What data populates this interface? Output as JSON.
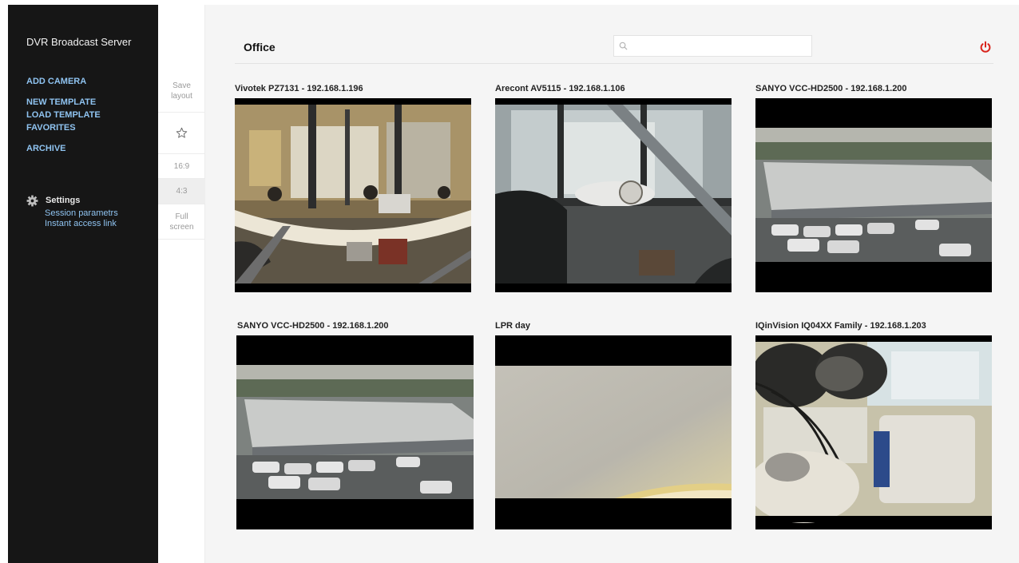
{
  "app": {
    "brand": "DVR Broadcast Server"
  },
  "sidebar": {
    "add_camera": "ADD CAMERA",
    "new_template": "NEW TEMPLATE",
    "load_template": "LOAD TEMPLATE",
    "favorites": "FAVORITES",
    "archive": "ARCHIVE",
    "settings": {
      "label": "Settings",
      "icon": "gear-icon",
      "items": [
        "Session parametrs",
        "Instant access link"
      ]
    }
  },
  "tools": {
    "save_layout_line1": "Save",
    "save_layout_line2": "layout",
    "favorite_icon": "star-icon",
    "ratio_16_9": "16:9",
    "ratio_4_3": "4:3",
    "active_ratio": "4:3",
    "fullscreen_line1": "Full",
    "fullscreen_line2": "screen"
  },
  "header": {
    "title": "Office",
    "search_placeholder": "",
    "search_icon": "search-icon",
    "power_icon": "power-icon"
  },
  "cameras": [
    {
      "label": "Vivotek PZ7131 - 192.168.1.196"
    },
    {
      "label": "Arecont AV5115 - 192.168.1.106"
    },
    {
      "label": "SANYO VCC-HD2500 - 192.168.1.200"
    },
    {
      "label": "SANYO VCC-HD2500 - 192.168.1.200"
    },
    {
      "label": "LPR day"
    },
    {
      "label": "IQinVision IQ04XX Family - 192.168.1.203"
    }
  ],
  "colors": {
    "sidebar_bg": "#161616",
    "link": "#8fc3f0",
    "power": "#d9241c",
    "main_bg": "#f5f5f5"
  }
}
